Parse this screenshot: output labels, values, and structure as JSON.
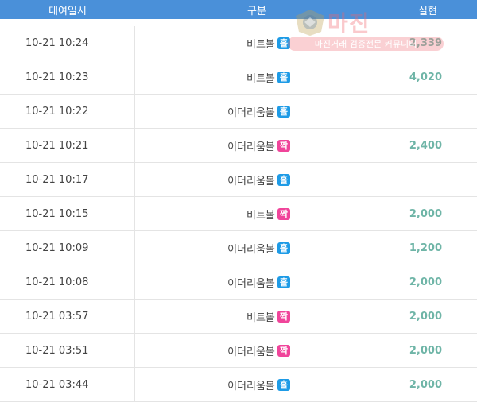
{
  "header": {
    "date_col": "대여일시",
    "type_col": "구분",
    "amount_col": "실현"
  },
  "rows": [
    {
      "date": "10-21 10:24",
      "type": "비트볼",
      "badge": "홀",
      "badge_kind": "odd",
      "amount": "2,339"
    },
    {
      "date": "10-21 10:23",
      "type": "비트볼",
      "badge": "홀",
      "badge_kind": "odd",
      "amount": "4,020"
    },
    {
      "date": "10-21 10:22",
      "type": "이더리움볼",
      "badge": "홀",
      "badge_kind": "odd",
      "amount": ""
    },
    {
      "date": "10-21 10:21",
      "type": "이더리움볼",
      "badge": "짝",
      "badge_kind": "even",
      "amount": "2,400"
    },
    {
      "date": "10-21 10:17",
      "type": "이더리움볼",
      "badge": "홀",
      "badge_kind": "odd",
      "amount": ""
    },
    {
      "date": "10-21 10:15",
      "type": "비트볼",
      "badge": "짝",
      "badge_kind": "even",
      "amount": "2,000"
    },
    {
      "date": "10-21 10:09",
      "type": "이더리움볼",
      "badge": "홀",
      "badge_kind": "odd",
      "amount": "1,200"
    },
    {
      "date": "10-21 10:08",
      "type": "이더리움볼",
      "badge": "홀",
      "badge_kind": "odd",
      "amount": "2,000"
    },
    {
      "date": "10-21 03:57",
      "type": "비트볼",
      "badge": "짝",
      "badge_kind": "even",
      "amount": "2,000"
    },
    {
      "date": "10-21 03:51",
      "type": "이더리움볼",
      "badge": "짝",
      "badge_kind": "even",
      "amount": "2,000"
    },
    {
      "date": "10-21 03:44",
      "type": "이더리움볼",
      "badge": "홀",
      "badge_kind": "odd",
      "amount": "2,000"
    }
  ],
  "watermark": {
    "title": "마진",
    "subtitle": "마진거래 검증전문 커뮤니티"
  },
  "colors": {
    "header_bg": "#4a90d9",
    "odd_badge": "#1e9be6",
    "even_badge": "#f0449a",
    "amount": "#6fb5a7"
  }
}
